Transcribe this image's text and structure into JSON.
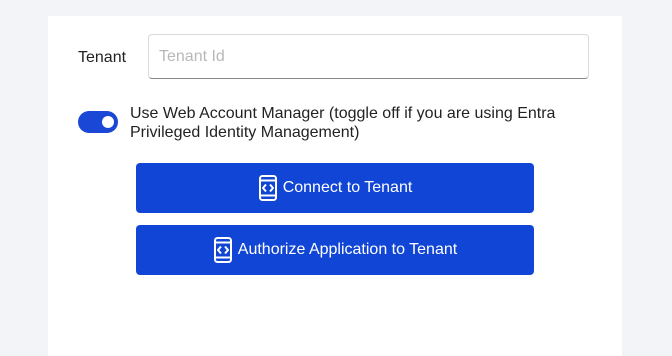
{
  "form": {
    "tenant_label": "Tenant",
    "tenant_placeholder": "Tenant Id",
    "tenant_value": "",
    "wam_toggle_on": true,
    "wam_label": "Use Web Account Manager (toggle off if you are using Entra Privileged Identity Management)"
  },
  "buttons": {
    "connect_label": "Connect to Tenant",
    "authorize_label": "Authorize Application to Tenant",
    "icon": "mobile-code-icon"
  },
  "colors": {
    "accent": "#1145d6",
    "toggle": "#1b47d6",
    "background": "#f2f4f7",
    "panel": "#ffffff"
  }
}
